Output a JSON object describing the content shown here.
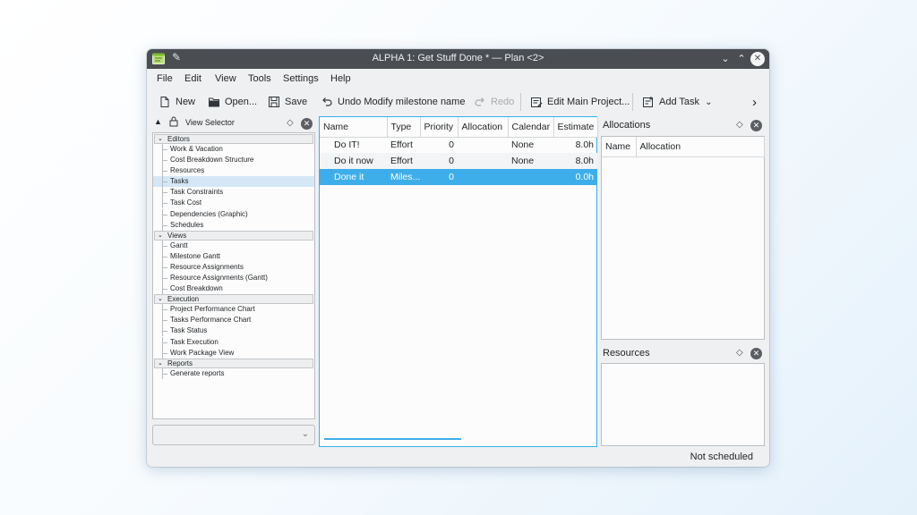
{
  "window": {
    "title": "ALPHA 1: Get Stuff Done * — Plan <2>",
    "controls": {
      "minimize": "⌄",
      "maximize": "⌃",
      "close": "✕"
    }
  },
  "menu": [
    "File",
    "Edit",
    "View",
    "Tools",
    "Settings",
    "Help"
  ],
  "toolbar": {
    "new": "New",
    "open": "Open...",
    "save": "Save",
    "undo": "Undo Modify milestone name",
    "redo": "Redo",
    "edit_main_project": "Edit Main Project...",
    "add_task": "Add Task",
    "overflow": "›"
  },
  "view_selector": {
    "title": "View Selector",
    "sections": [
      {
        "label": "Editors",
        "items": [
          "Work & Vacation",
          "Cost Breakdown Structure",
          "Resources",
          "Tasks",
          "Task Constraints",
          "Task Cost",
          "Dependencies (Graphic)",
          "Schedules"
        ]
      },
      {
        "label": "Views",
        "items": [
          "Gantt",
          "Milestone Gantt",
          "Resource Assignments",
          "Resource Assignments (Gantt)",
          "Cost Breakdown"
        ]
      },
      {
        "label": "Execution",
        "items": [
          "Project Performance Chart",
          "Tasks Performance Chart",
          "Task Status",
          "Task Execution",
          "Work Package View"
        ]
      },
      {
        "label": "Reports",
        "items": [
          "Generate reports"
        ]
      }
    ],
    "selected_item": "Tasks",
    "combo_value": ""
  },
  "tasks_table": {
    "columns": [
      "Name",
      "Type",
      "Priority",
      "Allocation",
      "Calendar",
      "Estimate"
    ],
    "rows": [
      [
        "Do IT!",
        "Effort",
        "0",
        "",
        "None",
        "8.0h"
      ],
      [
        "Do it now",
        "Effort",
        "0",
        "",
        "None",
        "8.0h"
      ],
      [
        "Done it",
        "Miles...",
        "0",
        "",
        "",
        "0.0h"
      ]
    ],
    "selected_row": 2
  },
  "allocations": {
    "title": "Allocations",
    "columns": [
      "Name",
      "Allocation"
    ]
  },
  "resources": {
    "title": "Resources"
  },
  "status": {
    "text": "Not scheduled"
  },
  "icons": {
    "float": "◇",
    "close": "✕",
    "lock": "🔒",
    "collapse_all": "▲",
    "section_chevron": "⌄",
    "dropdown_chevron": "⌄"
  },
  "colors": {
    "selection": "#3daee9",
    "titlebar": "#4a4e53",
    "window_bg": "#eff0f1"
  }
}
